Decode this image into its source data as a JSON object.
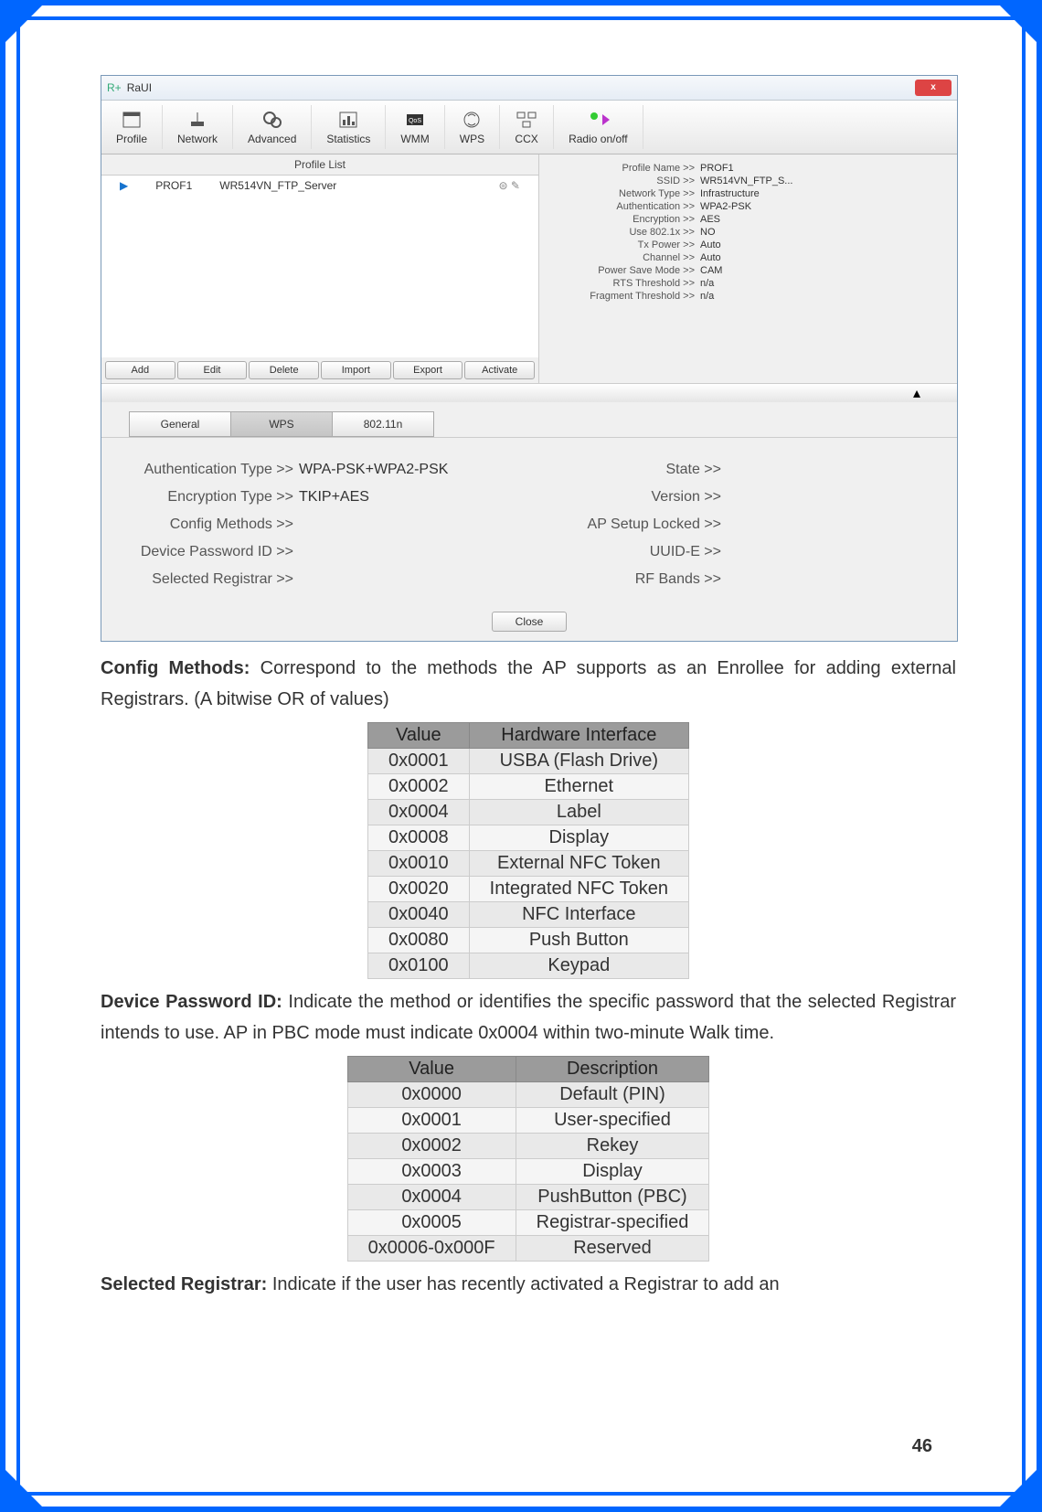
{
  "app": {
    "title": "RaUI",
    "close": "x",
    "toolbar": [
      {
        "label": "Profile"
      },
      {
        "label": "Network"
      },
      {
        "label": "Advanced"
      },
      {
        "label": "Statistics"
      },
      {
        "label": "WMM"
      },
      {
        "label": "WPS"
      },
      {
        "label": "CCX"
      },
      {
        "label": "Radio on/off"
      }
    ],
    "profileList": {
      "header": "Profile List",
      "item": {
        "name": "PROF1",
        "ssid": "WR514VN_FTP_Server"
      }
    },
    "profileBtns": [
      "Add",
      "Edit",
      "Delete",
      "Import",
      "Export",
      "Activate"
    ],
    "details": [
      {
        "k": "Profile Name >>",
        "v": "PROF1"
      },
      {
        "k": "SSID >>",
        "v": "WR514VN_FTP_S..."
      },
      {
        "k": "Network Type >>",
        "v": "Infrastructure"
      },
      {
        "k": "Authentication >>",
        "v": "WPA2-PSK"
      },
      {
        "k": "Encryption >>",
        "v": "AES"
      },
      {
        "k": "Use 802.1x >>",
        "v": "NO"
      },
      {
        "k": "Tx Power >>",
        "v": "Auto"
      },
      {
        "k": "Channel >>",
        "v": "Auto"
      },
      {
        "k": "Power Save Mode >>",
        "v": "CAM"
      },
      {
        "k": "RTS Threshold >>",
        "v": "n/a"
      },
      {
        "k": "Fragment Threshold >>",
        "v": "n/a"
      }
    ],
    "subtabs": [
      "General",
      "WPS",
      "802.11n"
    ],
    "wpsLeft": [
      {
        "k": "Authentication Type >>",
        "v": "WPA-PSK+WPA2-PSK"
      },
      {
        "k": "Encryption Type >>",
        "v": "TKIP+AES"
      },
      {
        "k": "Config Methods >>",
        "v": ""
      },
      {
        "k": "Device Password ID >>",
        "v": ""
      },
      {
        "k": "Selected Registrar >>",
        "v": ""
      }
    ],
    "wpsRight": [
      {
        "k": "State >>",
        "v": ""
      },
      {
        "k": "Version >>",
        "v": ""
      },
      {
        "k": "AP Setup Locked >>",
        "v": ""
      },
      {
        "k": "UUID-E >>",
        "v": ""
      },
      {
        "k": "RF Bands >>",
        "v": ""
      }
    ],
    "closeBtn": "Close"
  },
  "doc": {
    "para1_b": "Config Methods:",
    "para1_t": " Correspond to the methods the AP supports as an Enrollee for adding external Registrars. (A bitwise OR of values)",
    "table1": {
      "headers": [
        "Value",
        "Hardware Interface"
      ],
      "rows": [
        [
          "0x0001",
          "USBA (Flash Drive)"
        ],
        [
          "0x0002",
          "Ethernet"
        ],
        [
          "0x0004",
          "Label"
        ],
        [
          "0x0008",
          "Display"
        ],
        [
          "0x0010",
          "External NFC Token"
        ],
        [
          "0x0020",
          "Integrated NFC Token"
        ],
        [
          "0x0040",
          "NFC Interface"
        ],
        [
          "0x0080",
          "Push Button"
        ],
        [
          "0x0100",
          "Keypad"
        ]
      ]
    },
    "para2_b": "Device Password ID:",
    "para2_t": " Indicate the method or identifies the specific password that the selected Registrar intends to use. AP in PBC mode must indicate 0x0004 within two-minute Walk time.",
    "table2": {
      "headers": [
        "Value",
        "Description"
      ],
      "rows": [
        [
          "0x0000",
          "Default (PIN)"
        ],
        [
          "0x0001",
          "User-specified"
        ],
        [
          "0x0002",
          "Rekey"
        ],
        [
          "0x0003",
          "Display"
        ],
        [
          "0x0004",
          "PushButton (PBC)"
        ],
        [
          "0x0005",
          "Registrar-specified"
        ],
        [
          "0x0006-0x000F",
          "Reserved"
        ]
      ]
    },
    "para3_b": "Selected Registrar:",
    "para3_t": " Indicate if the user has recently activated a Registrar to add an"
  },
  "pageNum": "46"
}
